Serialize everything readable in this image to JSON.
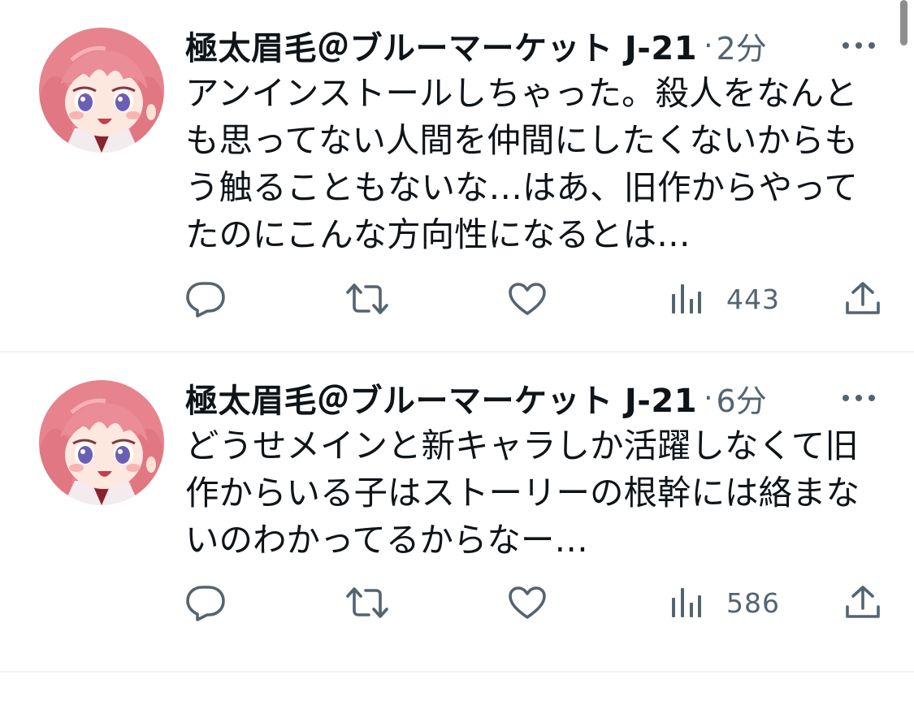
{
  "tweets": [
    {
      "display_name": "極太眉毛＠ブルーマーケット J-21",
      "separator": "·",
      "timestamp": "2分",
      "text": "アンインストールしちゃった。殺人をなんとも思ってない人間を仲間にしたくないからもう触ることもないな…はあ、旧作からやってたのにこんな方向性になるとは…",
      "views": "443"
    },
    {
      "display_name": "極太眉毛＠ブルーマーケット J-21",
      "separator": "·",
      "timestamp": "6分",
      "text": "どうせメインと新キャラしか活躍しなくて旧作からいる子はストーリーの根幹には絡まないのわかってるからなー…",
      "views": "586"
    }
  ],
  "icons": {
    "more": "more-icon",
    "reply": "reply-icon",
    "retweet": "retweet-icon",
    "like": "like-icon",
    "views": "views-icon",
    "share": "share-icon"
  },
  "colors": {
    "text_primary": "#0f1419",
    "text_secondary": "#536471",
    "divider": "#eff3f4",
    "avatar_hair": "#e9858f",
    "avatar_eyes": "#6b5fb5"
  }
}
